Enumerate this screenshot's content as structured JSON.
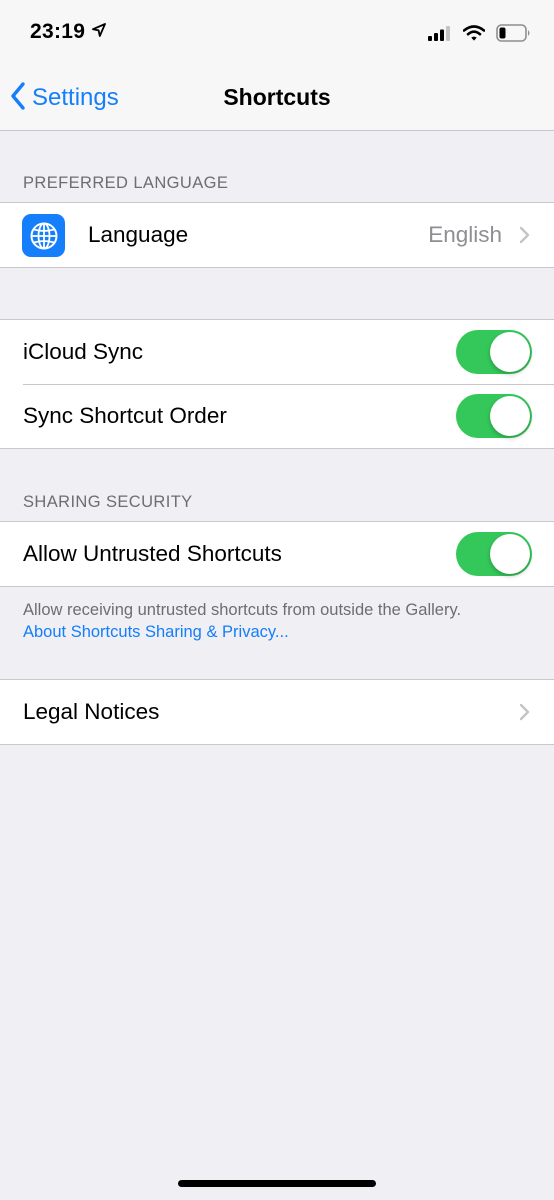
{
  "status_bar": {
    "time": "23:19",
    "location_icon": "location-arrow-icon",
    "signal_icon": "cellular-signal-icon",
    "wifi_icon": "wifi-icon",
    "battery_icon": "battery-icon"
  },
  "nav": {
    "back_label": "Settings",
    "title": "Shortcuts"
  },
  "sections": {
    "preferred_language": {
      "header": "PREFERRED LANGUAGE",
      "language_label": "Language",
      "language_value": "English"
    },
    "sync": {
      "icloud_label": "iCloud Sync",
      "icloud_on": true,
      "order_label": "Sync Shortcut Order",
      "order_on": true
    },
    "sharing_security": {
      "header": "SHARING SECURITY",
      "untrusted_label": "Allow Untrusted Shortcuts",
      "untrusted_on": true,
      "footer_text": "Allow receiving untrusted shortcuts from outside the Gallery.",
      "footer_link": "About Shortcuts Sharing & Privacy..."
    },
    "legal": {
      "notices_label": "Legal Notices"
    }
  },
  "colors": {
    "accent": "#147efb",
    "toggle_on": "#34c759",
    "background": "#efeff4"
  }
}
